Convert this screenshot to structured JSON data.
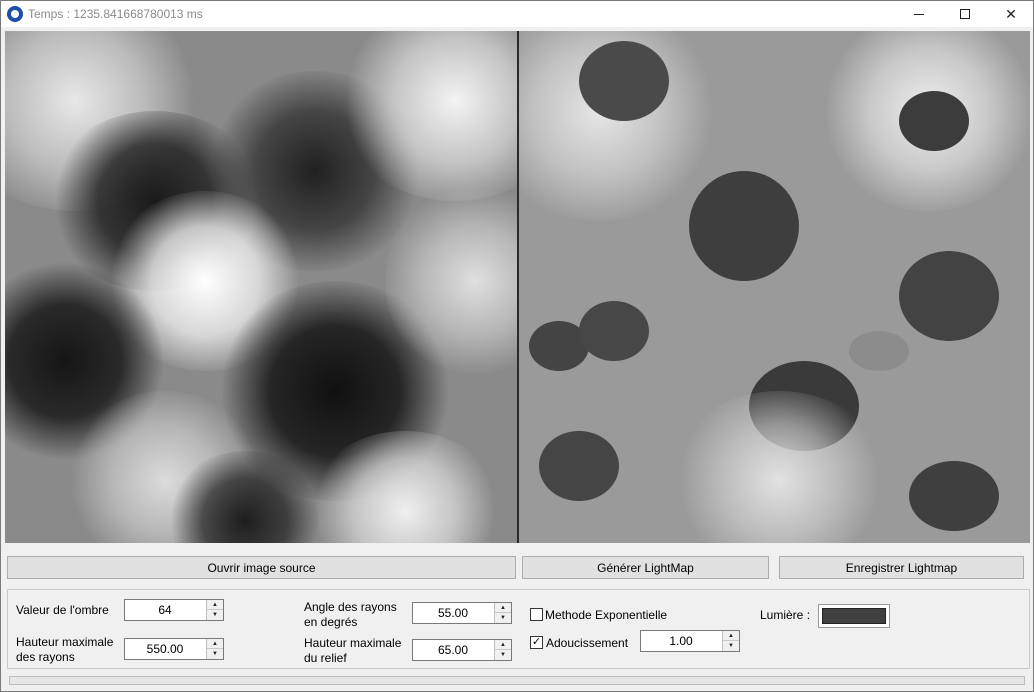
{
  "window": {
    "title": "Temps : 1235.841668780013 ms",
    "app_icon": "paw-icon",
    "controls": [
      "minimize-icon",
      "maximize-icon",
      "close-icon"
    ]
  },
  "images": {
    "source_description": "heightmap",
    "lightmap_description": "lightmap"
  },
  "buttons": {
    "open": "Ouvrir image source",
    "generate": "Générer LightMap",
    "save": "Enregistrer Lightmap"
  },
  "params": {
    "shadow_label": "Valeur de l'ombre",
    "shadow_value": "64",
    "ray_height_label_1": "Hauteur maximale",
    "ray_height_label_2": "des rayons",
    "ray_height_value": "550.00",
    "angle_label_1": "Angle des rayons",
    "angle_label_2": "en degrés",
    "angle_value": "55.00",
    "relief_label_1": "Hauteur maximale",
    "relief_label_2": "du relief",
    "relief_value": "65.00",
    "exponential_label": "Methode Exponentielle",
    "exponential_checked": false,
    "smoothing_label": "Adoucissement",
    "smoothing_checked": true,
    "smoothing_value": "1.00",
    "light_label": "Lumière :",
    "light_color": "#404040"
  },
  "progress": 0
}
